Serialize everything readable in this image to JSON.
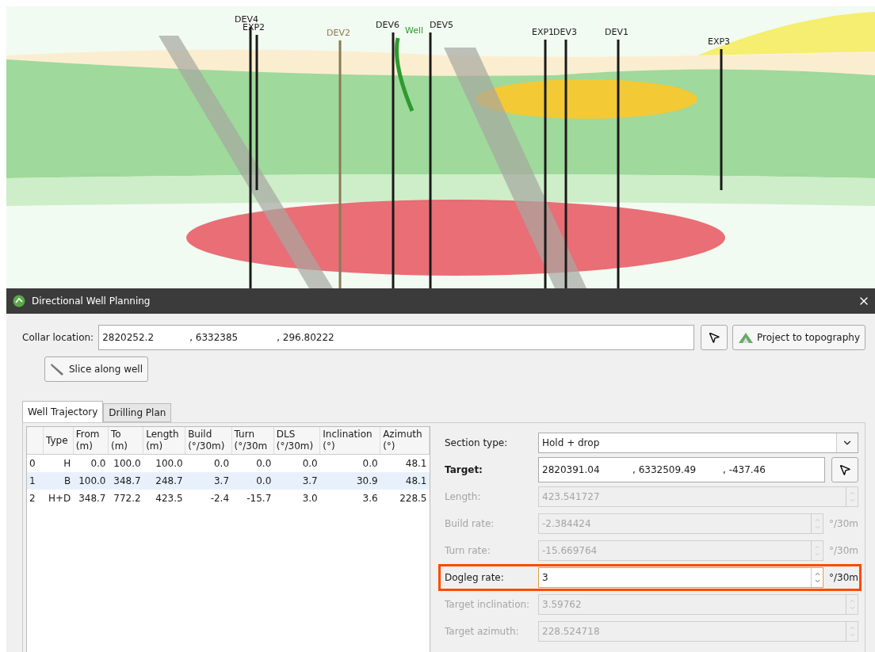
{
  "viewer": {
    "wells": [
      {
        "label": "DEV4",
        "color": "#1a1a1a"
      },
      {
        "label": "EXP2",
        "color": "#1a1a1a"
      },
      {
        "label": "DEV2",
        "color": "#8a7a55"
      },
      {
        "label": "DEV6",
        "color": "#1a1a1a"
      },
      {
        "label": "Well",
        "color": "#2e9a2e"
      },
      {
        "label": "DEV5",
        "color": "#1a1a1a"
      },
      {
        "label": "EXP1",
        "color": "#1a1a1a"
      },
      {
        "label": "DEV3",
        "color": "#1a1a1a"
      },
      {
        "label": "DEV1",
        "color": "#1a1a1a"
      },
      {
        "label": "EXP3",
        "color": "#1a1a1a"
      }
    ]
  },
  "dialog": {
    "title": "Directional Well Planning",
    "collar": {
      "label": "Collar location:",
      "values": [
        "2820252.2",
        ", 6332385",
        ", 296.80222"
      ]
    },
    "project_button": "Project to topography",
    "slice_button": "Slice along well",
    "tabs": [
      {
        "label": "Well Trajectory",
        "selected": true
      },
      {
        "label": "Drilling Plan",
        "selected": false
      }
    ],
    "table": {
      "columns": [
        "",
        "Type",
        "From\n(m)",
        "To\n(m)",
        "Length\n(m)",
        "Build\n(°/30m)",
        "Turn\n(°/30m",
        "DLS\n(°/30m)",
        "Inclination\n(°)",
        "Azimuth\n(°)"
      ],
      "rows": [
        {
          "selected": false,
          "cells": [
            "0",
            "H",
            "0.0",
            "100.0",
            "100.0",
            "0.0",
            "0.0",
            "0.0",
            "0.0",
            "48.1"
          ]
        },
        {
          "selected": true,
          "cells": [
            "1",
            "B",
            "100.0",
            "348.7",
            "248.7",
            "3.7",
            "0.0",
            "3.7",
            "30.9",
            "48.1"
          ]
        },
        {
          "selected": false,
          "cells": [
            "2",
            "H+D",
            "348.7",
            "772.2",
            "423.5",
            "-2.4",
            "-15.7",
            "3.0",
            "3.6",
            "228.5"
          ]
        }
      ]
    },
    "fields": [
      {
        "kind": "select",
        "label": "Section type:",
        "value": "Hold + drop",
        "disabled": false,
        "highlighted": false
      },
      {
        "kind": "point",
        "label": "Target:",
        "values": [
          "2820391.04",
          ", 6332509.49",
          ", -437.46"
        ],
        "disabled": false,
        "highlighted": false
      },
      {
        "kind": "spin",
        "label": "Length:",
        "value": "423.541727",
        "disabled": true,
        "highlighted": false
      },
      {
        "kind": "spin",
        "label": "Build rate:",
        "value": "-2.384424",
        "unit": "°/30m",
        "disabled": true,
        "highlighted": false
      },
      {
        "kind": "spin",
        "label": "Turn rate:",
        "value": "-15.669764",
        "unit": "°/30m",
        "disabled": true,
        "highlighted": false
      },
      {
        "kind": "spin",
        "label": "Dogleg rate:",
        "value": "3",
        "unit": "°/30m",
        "disabled": false,
        "highlighted": true
      },
      {
        "kind": "spin",
        "label": "Target inclination:",
        "value": "3.59762",
        "disabled": true,
        "highlighted": false
      },
      {
        "kind": "spin",
        "label": "Target azimuth:",
        "value": "228.524718",
        "disabled": true,
        "highlighted": false
      }
    ]
  }
}
